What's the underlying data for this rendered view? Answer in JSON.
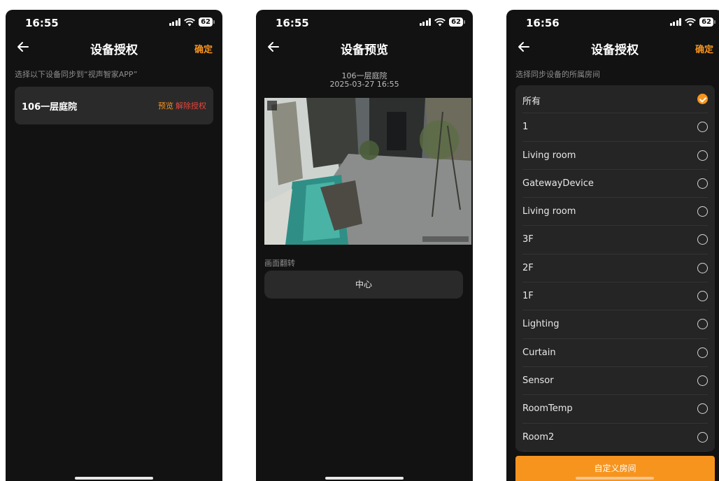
{
  "screens": [
    {
      "status": {
        "time": "16:55",
        "battery": "62"
      },
      "title": "设备授权",
      "confirm_label": "确定",
      "hint": "选择以下设备同步到“视声智家APP”",
      "device": {
        "name": "106一层庭院",
        "preview_label": "预览",
        "revoke_label": "解除授权"
      }
    },
    {
      "status": {
        "time": "16:55",
        "battery": "62"
      },
      "title": "设备预览",
      "device_name": "106一层庭院",
      "timestamp": "2025-03-27 16:55",
      "flip_label": "画面翻转",
      "flip_value": "中心"
    },
    {
      "status": {
        "time": "16:56",
        "battery": "62"
      },
      "title": "设备授权",
      "confirm_label": "确定",
      "hint": "选择同步设备的所属房间",
      "rooms": [
        {
          "label": "所有",
          "selected": true
        },
        {
          "label": "1",
          "selected": false
        },
        {
          "label": "Living room",
          "selected": false
        },
        {
          "label": "GatewayDevice",
          "selected": false
        },
        {
          "label": "Living room",
          "selected": false
        },
        {
          "label": "3F",
          "selected": false
        },
        {
          "label": "2F",
          "selected": false
        },
        {
          "label": "1F",
          "selected": false
        },
        {
          "label": "Lighting",
          "selected": false
        },
        {
          "label": "Curtain",
          "selected": false
        },
        {
          "label": "Sensor",
          "selected": false
        },
        {
          "label": "RoomTemp",
          "selected": false
        },
        {
          "label": "Room2",
          "selected": false
        }
      ],
      "custom_room_label": "自定义房间"
    }
  ],
  "colors": {
    "accent": "#f7941d",
    "danger": "#e8463c",
    "background": "#121212",
    "card": "#2a2a2a"
  }
}
